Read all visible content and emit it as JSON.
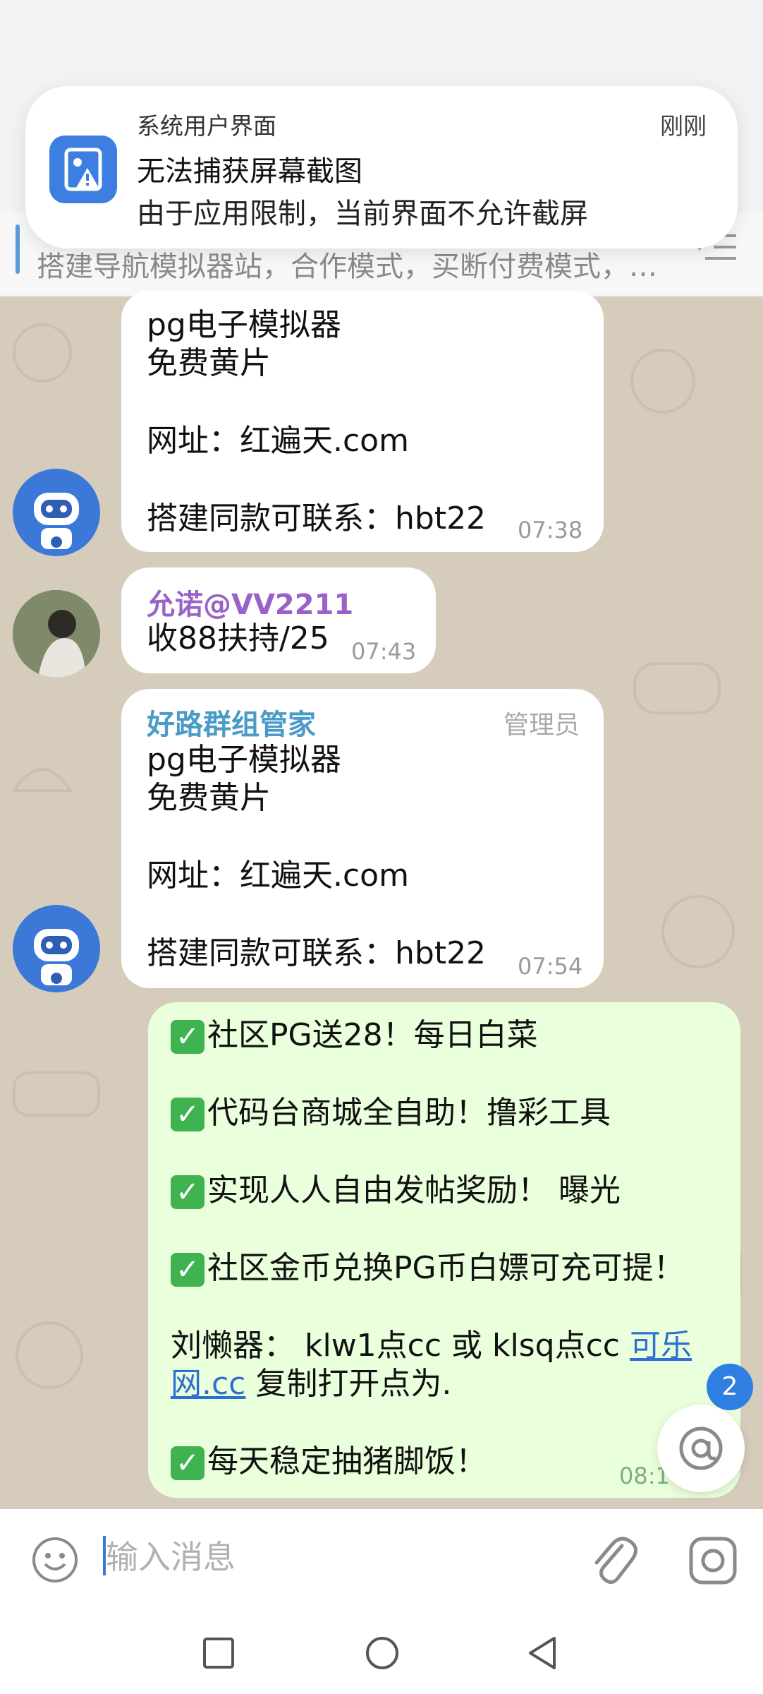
{
  "notification": {
    "app_name": "系统用户界面",
    "time": "刚刚",
    "title": "无法捕获屏幕截图",
    "body": "由于应用限制，当前界面不允许截屏"
  },
  "pinned": {
    "text": "搭建导航模拟器站，合作模式，买断付费模式，…"
  },
  "messages": [
    {
      "lines": [
        "pg电子模拟器",
        "免费黄片",
        "",
        "网址：红遍天.com",
        "",
        "搭建同款可联系：hbt22"
      ],
      "time": "07:38"
    },
    {
      "sender": "允诺@VV2211",
      "lines": [
        "收88扶持/25"
      ],
      "time": "07:43"
    },
    {
      "sender": "好路群组管家",
      "role": "管理员",
      "lines": [
        "pg电子模拟器",
        "免费黄片",
        "",
        "网址：红遍天.com",
        "",
        "搭建同款可联系：hbt22"
      ],
      "time": "07:54"
    },
    {
      "items": [
        "社区PG送28！每日白菜",
        "代码台商城全自助！撸彩工具",
        "实现人人自由发帖奖励！ 曝光",
        "社区金币兑换PG币白嫖可充可提！"
      ],
      "line_a": "刘懒器： klw1点cc 或 klsq点cc ",
      "link_a": "可乐",
      "link_b": "网.cc",
      "line_b": " 复制打开点为.",
      "item_last": "每天稳定抽猪脚饭！",
      "time": "08:1"
    }
  ],
  "mention_badge": "2",
  "input": {
    "placeholder": "输入消息"
  },
  "colors": {
    "accent": "#3a78d8",
    "sender_admin": "#4a9bc7",
    "sender_user": "#9a62c9",
    "chat_bg": "#d6ccbb",
    "own_bubble": "#eaffdc"
  },
  "icons": {
    "notif": "screenshot-blocked-icon",
    "emoji": "smiley-icon",
    "attach": "paperclip-icon",
    "camera": "instagram-camera-icon",
    "mention": "at-sign-icon",
    "nav": [
      "square-icon",
      "circle-icon",
      "back-triangle-icon"
    ]
  }
}
